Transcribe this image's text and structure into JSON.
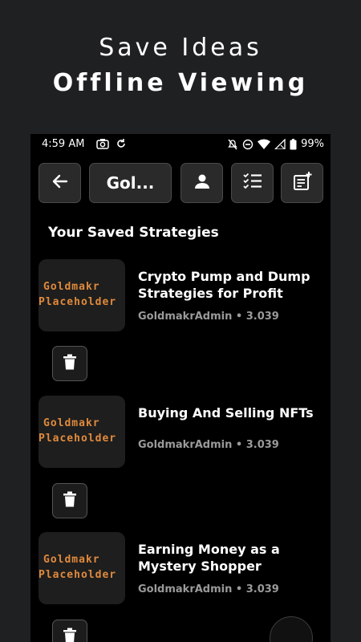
{
  "promo": {
    "line1": "Save Ideas",
    "line2": "Offline Viewing"
  },
  "status_bar": {
    "time": "4:59 AM",
    "battery": "99%",
    "icons_left": [
      "camera-icon",
      "sync-icon"
    ],
    "icons_right": [
      "mute-icon",
      "do-not-disturb-icon",
      "wifi-icon",
      "signal-icon",
      "battery-icon"
    ]
  },
  "toolbar": {
    "back_icon": "arrow-left-icon",
    "title": "Gol...",
    "buttons": [
      "user-icon",
      "checklist-icon",
      "note-add-icon"
    ]
  },
  "section_heading": "Your Saved Strategies",
  "strategies": [
    {
      "thumb_line1": "Goldmakr",
      "thumb_line2": "Placeholder",
      "title": "Crypto Pump and Dump Strategies for Profit",
      "meta": "GoldmakrAdmin • 3.039"
    },
    {
      "thumb_line1": "Goldmakr",
      "thumb_line2": "Placeholder",
      "title": "Buying And Selling NFTs",
      "meta": "GoldmakrAdmin • 3.039"
    },
    {
      "thumb_line1": "Goldmakr",
      "thumb_line2": "Placeholder",
      "title": "Earning Money as a Mystery Shopper",
      "meta": "GoldmakrAdmin • 3.039"
    }
  ],
  "colors": {
    "background": "#1f2022",
    "app_background": "#000000",
    "thumb_accent": "#e08a3c",
    "meta_gray": "#9a9a9a"
  }
}
